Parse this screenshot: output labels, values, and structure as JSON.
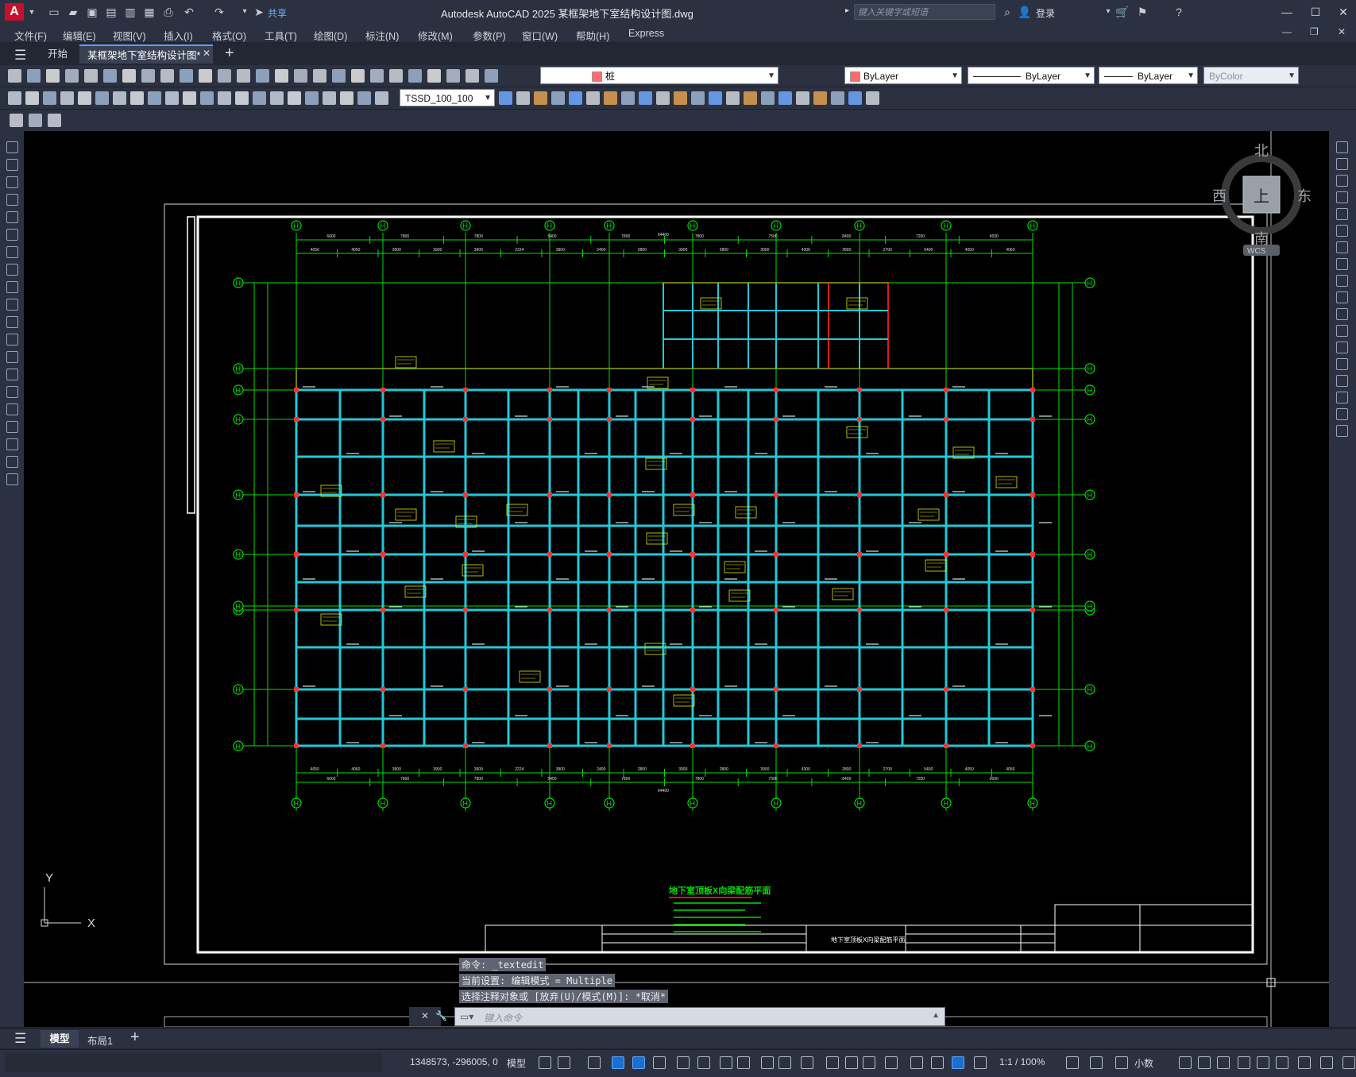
{
  "titlebar": {
    "share_label": "共享",
    "title": "Autodesk AutoCAD 2025    某框架地下室结构设计图.dwg",
    "search_placeholder": "键入关键字或短语",
    "login_label": "登录"
  },
  "menu": [
    "文件(F)",
    "编辑(E)",
    "视图(V)",
    "插入(I)",
    "格式(O)",
    "工具(T)",
    "绘图(D)",
    "标注(N)",
    "修改(M)",
    "参数(P)",
    "窗口(W)",
    "帮助(H)",
    "Express"
  ],
  "tabs": {
    "start_label": "开始",
    "doc_label": "某框架地下室结构设计图*"
  },
  "properties": {
    "layer_name": "桩",
    "color": "ByLayer",
    "linetype": "ByLayer",
    "lineweight": "ByLayer",
    "plotstyle": "ByColor",
    "dimstyle": "TSSD_100_100"
  },
  "viewcube": {
    "north": "北",
    "south": "南",
    "east": "东",
    "west": "西",
    "top": "上",
    "wcs": "WCS"
  },
  "drawing": {
    "title": "地下室顶板X向梁配筋平面",
    "sheet_name": "地下室顶板X向梁配筋平面",
    "axis_label": "H",
    "grid_color": "#00e000",
    "beam_color": "#22c8d8",
    "wall_color": "#e01818",
    "tag_color": "#e8e800",
    "overall_dim": "64400",
    "top_dims_1": [
      "6600",
      "7800",
      "7800",
      "5400",
      "7800",
      "7800",
      "7500",
      "8400",
      "7200",
      "5600"
    ],
    "top_dims_2": [
      "4050",
      "4050",
      "3900",
      "3900",
      "3900",
      "2224",
      "3900",
      "2400",
      "2800",
      "3900",
      "2800",
      "3900",
      "4300",
      "2800",
      "2700",
      "5400",
      "4050",
      "4050"
    ]
  },
  "command": {
    "history": [
      "命令: _textedit",
      "当前设置: 编辑模式 = Multiple",
      "选择注释对象或 [放弃(U)/模式(M)]: *取消*"
    ],
    "placeholder": "键入命令"
  },
  "ucs": {
    "x": "X",
    "y": "Y"
  },
  "layout_tabs": [
    "模型",
    "布局1"
  ],
  "status": {
    "coords": "1348573, -296005, 0",
    "model_label": "模型",
    "scale": "1:1 / 100%",
    "units": "小数"
  }
}
